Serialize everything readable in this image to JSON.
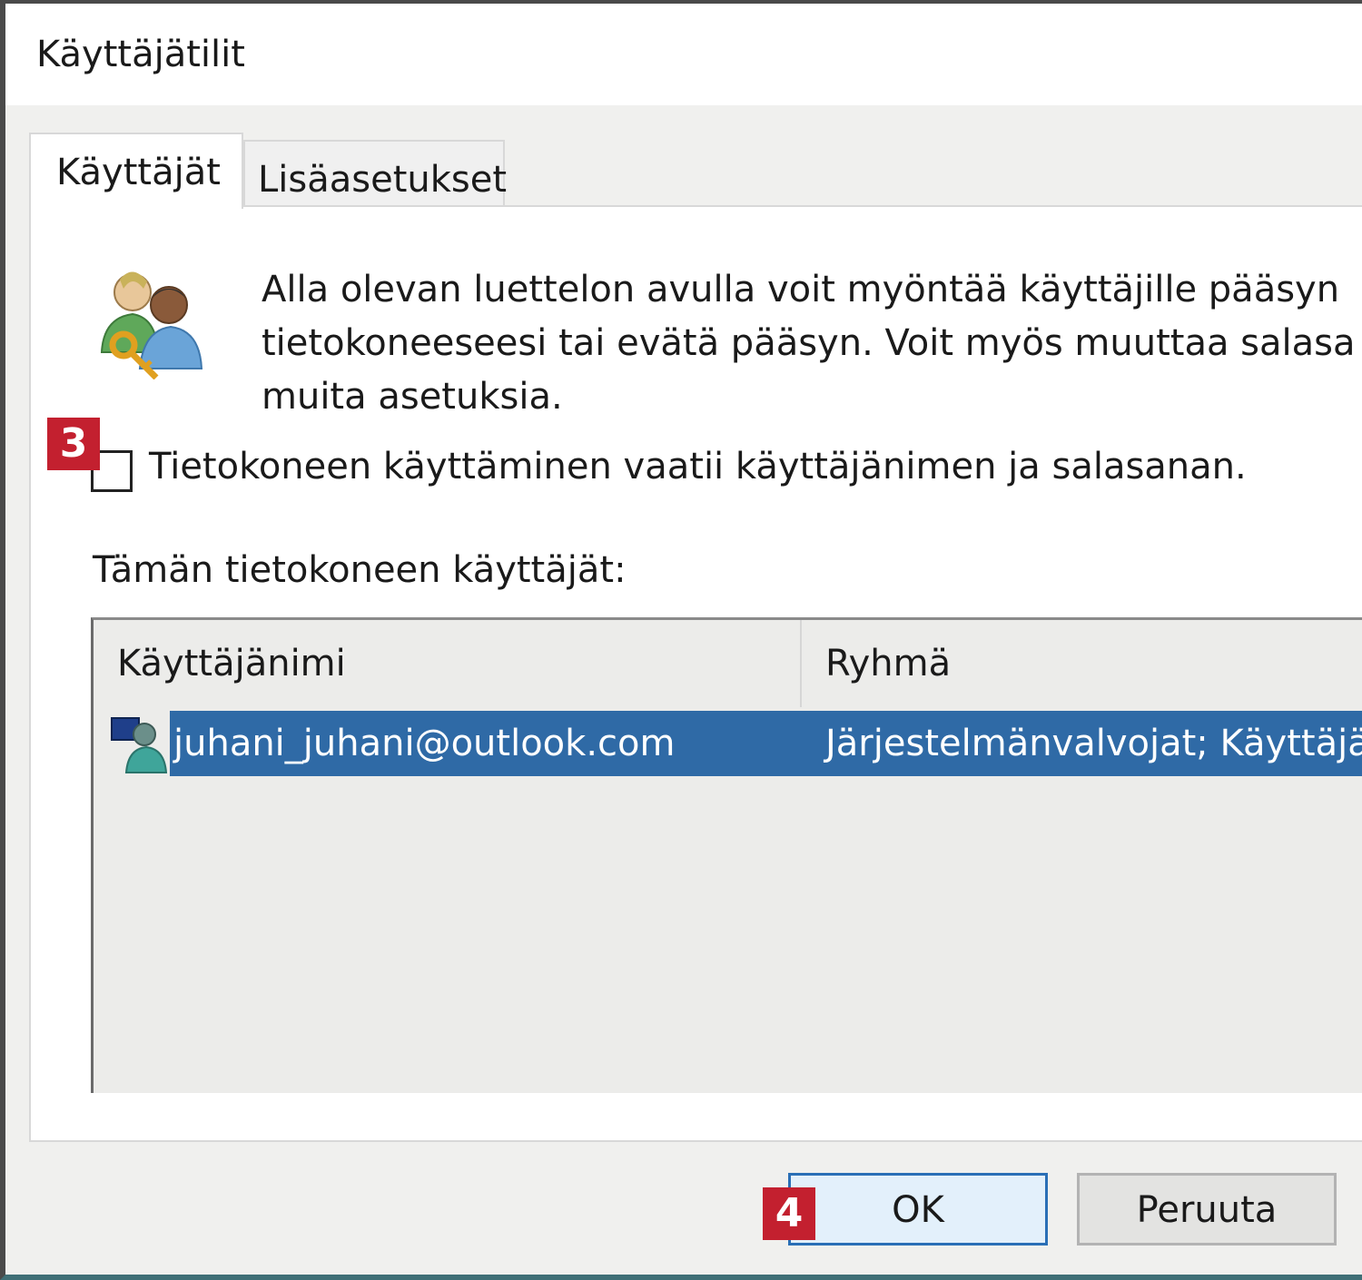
{
  "window": {
    "title": "Käyttäjätilit"
  },
  "tabs": [
    {
      "label": "Käyttäjät",
      "selected": true
    },
    {
      "label": "Lisäasetukset",
      "selected": false
    }
  ],
  "intro": {
    "lines": [
      "Alla olevan luettelon avulla voit myöntää käyttäjille pääsyn",
      "tietokoneeseesi tai evätä pääsyn. Voit myös muuttaa salasa",
      "muita asetuksia."
    ]
  },
  "require_login": {
    "label": "Tietokoneen käyttäminen vaatii käyttäjänimen ja salasanan.",
    "checked": false
  },
  "users_section": {
    "label": "Tämän tietokoneen käyttäjät:",
    "columns": [
      "Käyttäjänimi",
      "Ryhmä"
    ],
    "rows": [
      {
        "username": "juhani_juhani@outlook.com",
        "group": "Järjestelmänvalvojat; Käyttäjä",
        "selected": true
      }
    ]
  },
  "buttons": {
    "ok": "OK",
    "cancel": "Peruuta"
  },
  "markers": {
    "step_3": "3",
    "step_4": "4"
  },
  "colors": {
    "selection": "#2f6aa6",
    "marker": "#c3202f",
    "ok_border": "#2a6fb6"
  },
  "icons": {
    "users": "users-key-icon",
    "user_row": "user-account-icon"
  }
}
